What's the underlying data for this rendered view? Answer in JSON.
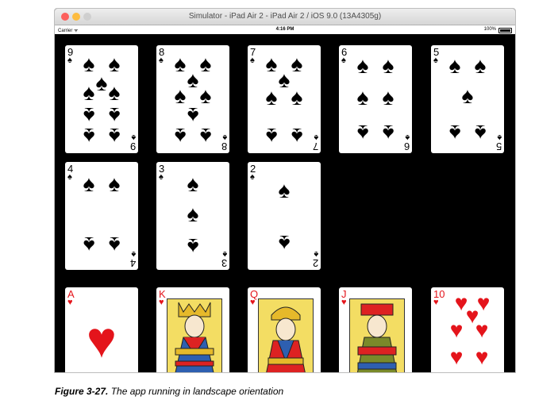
{
  "window": {
    "title": "Simulator - iPad Air 2 - iPad Air 2 / iOS 9.0 (13A4305g)"
  },
  "statusbar": {
    "carrier": "Carrier ᯤ",
    "time": "4:16 PM",
    "battery": "100%"
  },
  "cards": [
    {
      "rank": "9",
      "suit": "♠",
      "color": "#000000"
    },
    {
      "rank": "8",
      "suit": "♠",
      "color": "#000000"
    },
    {
      "rank": "7",
      "suit": "♠",
      "color": "#000000"
    },
    {
      "rank": "6",
      "suit": "♠",
      "color": "#000000"
    },
    {
      "rank": "5",
      "suit": "♠",
      "color": "#000000"
    },
    {
      "rank": "4",
      "suit": "♠",
      "color": "#000000"
    },
    {
      "rank": "3",
      "suit": "♠",
      "color": "#000000"
    },
    {
      "rank": "2",
      "suit": "♠",
      "color": "#000000"
    },
    {
      "rank": "A",
      "suit": "♥",
      "color": "#e4141b"
    },
    {
      "rank": "K",
      "suit": "♥",
      "color": "#e4141b"
    },
    {
      "rank": "Q",
      "suit": "♥",
      "color": "#e4141b"
    },
    {
      "rank": "J",
      "suit": "♥",
      "color": "#e4141b"
    },
    {
      "rank": "10",
      "suit": "♥",
      "color": "#e4141b"
    }
  ],
  "caption": {
    "label": "Figure 3-27.",
    "text": "The app running in landscape orientation"
  }
}
